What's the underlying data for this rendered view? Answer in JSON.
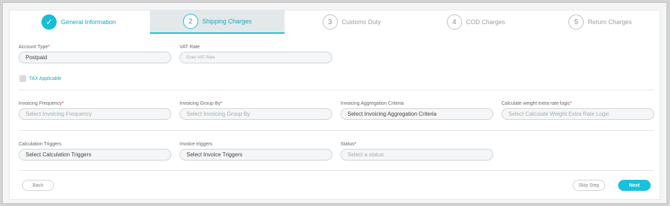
{
  "stepper": {
    "steps": [
      {
        "number": "✓",
        "label": "General Information"
      },
      {
        "number": "2",
        "label": "Shipping Charges"
      },
      {
        "number": "3",
        "label": "Customs Duty"
      },
      {
        "number": "4",
        "label": "COD Charges"
      },
      {
        "number": "5",
        "label": "Return Charges"
      }
    ]
  },
  "form": {
    "account_type": {
      "label": "Account Type",
      "required": "*",
      "value": "Postpaid"
    },
    "vat_rate": {
      "label": "VAT Rate",
      "placeholder": "Enter VAT Rate"
    },
    "tax_applicable": {
      "label": "TAX Applicable"
    },
    "invoicing_frequency": {
      "label": "Invoicing Frequency",
      "required": "*",
      "placeholder": "Select Invoicing Frequency"
    },
    "invoicing_group_by": {
      "label": "Invoicing Group By",
      "required": "*",
      "placeholder": "Select Invoicing Group By"
    },
    "invoicing_aggregation": {
      "label": "Invoicing Aggregation Criteria",
      "value": "Select Invoicing Aggregation Criteria"
    },
    "weight_extra_rate": {
      "label": "Calculate weight extra rate logic",
      "required": "*",
      "placeholder": "Select Calculate Weight Extra Rate Logic"
    },
    "calculation_triggers": {
      "label": "Calculation Triggers",
      "value": "Select Calculation Triggers"
    },
    "invoice_triggers": {
      "label": "Invoice triggers",
      "value": "Select Invoice Triggers"
    },
    "status": {
      "label": "Status",
      "required": "*",
      "placeholder": "Select a status"
    }
  },
  "footer": {
    "back_label": "Back",
    "skip_label": "Skip Step",
    "next_label": "Next"
  },
  "colors": {
    "accent": "#19c2dc",
    "active_tab_bg": "#e3e8ea"
  }
}
